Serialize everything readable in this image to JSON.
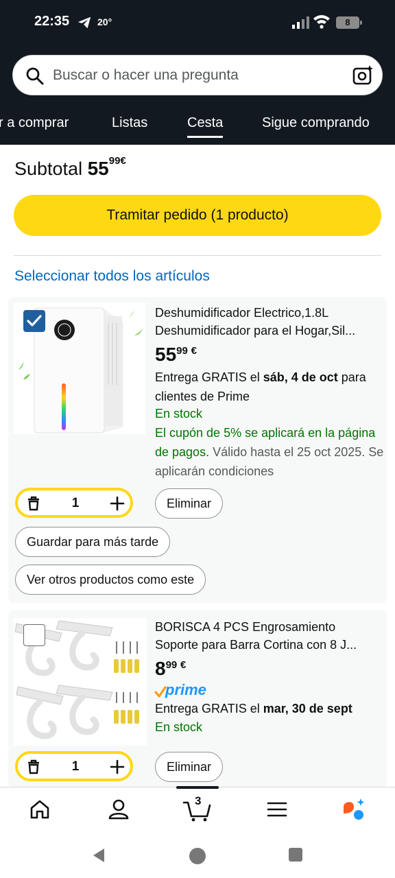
{
  "status": {
    "time": "22:35",
    "temp": "20°",
    "battery": "8"
  },
  "search": {
    "placeholder": "Buscar o hacer una pregunta"
  },
  "nav": {
    "tabs": [
      "r a comprar",
      "Listas",
      "Cesta",
      "Sigue comprando"
    ],
    "active": "Cesta"
  },
  "subtotal": {
    "label": "Subtotal",
    "whole": "55",
    "fraction": "99",
    "currency": "€"
  },
  "checkout": {
    "label": "Tramitar pedido (1 producto)"
  },
  "select_all": "Seleccionar todos los artículos",
  "items": [
    {
      "title_line1": "Deshumidificador Electrico,1.8L",
      "title_line2": "Deshumidificador para el Hogar,Sil...",
      "price_whole": "55",
      "price_fraction": "99",
      "currency": "€",
      "delivery_pre": "Entrega GRATIS el ",
      "delivery_date": "sáb, 4 de oct",
      "delivery_post": " para clientes de Prime",
      "stock": "En stock",
      "coupon": "El cupón de 5% se aplicará en la página de pagos.",
      "coupon_note": " Válido hasta el 25 oct 2025. Se aplicarán condiciones",
      "checked": true,
      "qty": "1",
      "delete_label": "Eliminar",
      "save_label": "Guardar para más tarde",
      "similar_label": "Ver otros productos como este"
    },
    {
      "title_line1": "BORISCA 4 PCS Engrosamiento",
      "title_line2": "Soporte para Barra Cortina con 8 J...",
      "price_whole": "8",
      "price_fraction": "99",
      "currency": "€",
      "prime": "prime",
      "delivery_pre": "Entrega GRATIS el ",
      "delivery_date": "mar, 30 de sept",
      "stock": "En stock",
      "checked": false,
      "qty": "1",
      "delete_label": "Eliminar"
    }
  ],
  "bottom_nav": {
    "cart_count": "3",
    "items": [
      "home-icon",
      "account-icon",
      "cart-icon",
      "menu-icon",
      "rufus-icon"
    ]
  },
  "colors": {
    "header": "#131921",
    "accent": "#ffd814",
    "link": "#0066c0",
    "stock": "#007600",
    "prime": "#1a98ff"
  }
}
